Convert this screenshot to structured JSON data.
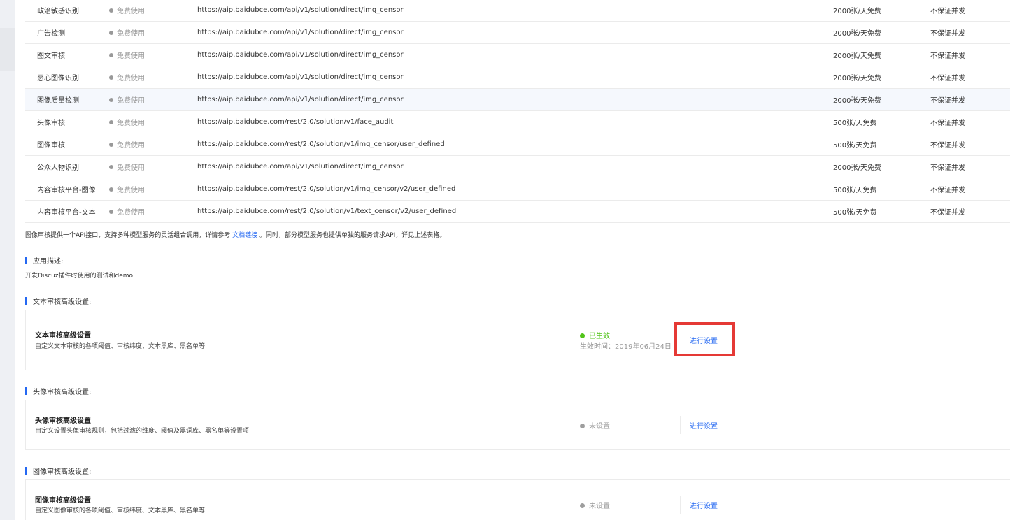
{
  "api_table": {
    "rows": [
      {
        "name": "政治敏感识别",
        "status": "免费使用",
        "url": "https://aip.baidubce.com/api/v1/solution/direct/img_censor",
        "quota": "2000张/天免费",
        "qps": "不保证并发"
      },
      {
        "name": "广告检测",
        "status": "免费使用",
        "url": "https://aip.baidubce.com/api/v1/solution/direct/img_censor",
        "quota": "2000张/天免费",
        "qps": "不保证并发"
      },
      {
        "name": "图文审核",
        "status": "免费使用",
        "url": "https://aip.baidubce.com/api/v1/solution/direct/img_censor",
        "quota": "2000张/天免费",
        "qps": "不保证并发"
      },
      {
        "name": "恶心图像识别",
        "status": "免费使用",
        "url": "https://aip.baidubce.com/api/v1/solution/direct/img_censor",
        "quota": "2000张/天免费",
        "qps": "不保证并发"
      },
      {
        "name": "图像质量检测",
        "status": "免费使用",
        "url": "https://aip.baidubce.com/api/v1/solution/direct/img_censor",
        "quota": "2000张/天免费",
        "qps": "不保证并发"
      },
      {
        "name": "头像审核",
        "status": "免费使用",
        "url": "https://aip.baidubce.com/rest/2.0/solution/v1/face_audit",
        "quota": "500张/天免费",
        "qps": "不保证并发"
      },
      {
        "name": "图像审核",
        "status": "免费使用",
        "url": "https://aip.baidubce.com/rest/2.0/solution/v1/img_censor/user_defined",
        "quota": "500张/天免费",
        "qps": "不保证并发"
      },
      {
        "name": "公众人物识别",
        "status": "免费使用",
        "url": "https://aip.baidubce.com/api/v1/solution/direct/img_censor",
        "quota": "2000张/天免费",
        "qps": "不保证并发"
      },
      {
        "name": "内容审核平台-图像",
        "status": "免费使用",
        "url": "https://aip.baidubce.com/rest/2.0/solution/v1/img_censor/v2/user_defined",
        "quota": "500张/天免费",
        "qps": "不保证并发"
      },
      {
        "name": "内容审核平台-文本",
        "status": "免费使用",
        "url": "https://aip.baidubce.com/rest/2.0/solution/v1/text_censor/v2/user_defined",
        "quota": "500张/天免费",
        "qps": "不保证并发"
      }
    ]
  },
  "note": {
    "before": "图像审核提供一个API接口，支持多种模型服务的灵活组合调用，详情参考",
    "link": "文档链接",
    "after": "。同时，部分模型服务也提供单独的服务请求API，详见上述表格。"
  },
  "app_desc": {
    "heading": "应用描述:",
    "text": "开发Discuz插件时使用的测试和demo"
  },
  "text_settings": {
    "heading": "文本审核高级设置:",
    "title": "文本审核高级设置",
    "desc": "自定义文本审核的各项阈值、审核纬度、文本黑库、黑名单等",
    "status": "已生效",
    "time": "生效时间：2019年06月24日",
    "action": "进行设置"
  },
  "avatar_settings": {
    "heading": "头像审核高级设置:",
    "title": "头像审核高级设置",
    "desc": "自定义设置头像审核规则，包括过滤的维度、阈值及黑词库、黑名单等设置项",
    "status": "未设置",
    "action": "进行设置"
  },
  "image_settings": {
    "heading": "图像审核高级设置:",
    "title": "图像审核高级设置",
    "desc": "自定义图像审核的各项阈值、审核纬度、文本黑库、黑名单等",
    "status": "未设置",
    "action": "进行设置"
  },
  "colors": {
    "accent": "#2468f2",
    "active_status": "#52c41a",
    "inactive_status": "#999999",
    "highlight_box": "#e53935"
  }
}
